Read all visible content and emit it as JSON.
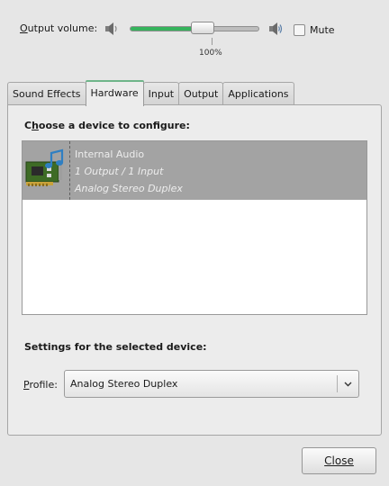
{
  "volume": {
    "label": "Output volume:",
    "value_text": "100%",
    "level": 0.56,
    "fill_color": "#35b35c",
    "left_icon": "speaker-low-icon",
    "right_icon": "speaker-high-icon",
    "mute_label": "Mute",
    "mute_checked": false
  },
  "tabs": [
    {
      "label": "Sound Effects",
      "active": false
    },
    {
      "label": "Hardware",
      "active": true
    },
    {
      "label": "Input",
      "active": false
    },
    {
      "label": "Output",
      "active": false
    },
    {
      "label": "Applications",
      "active": false
    }
  ],
  "hardware": {
    "choose_title": "Choose a device to configure:",
    "devices": [
      {
        "name": "Internal Audio",
        "ports": "1 Output / 1 Input",
        "profile": "Analog Stereo Duplex",
        "icon": "sound-card-icon",
        "selected": true
      }
    ],
    "settings_title": "Settings for the selected device:",
    "profile_label": "Profile:",
    "profile_value": "Analog Stereo Duplex"
  },
  "buttons": {
    "close_label": "Close"
  }
}
